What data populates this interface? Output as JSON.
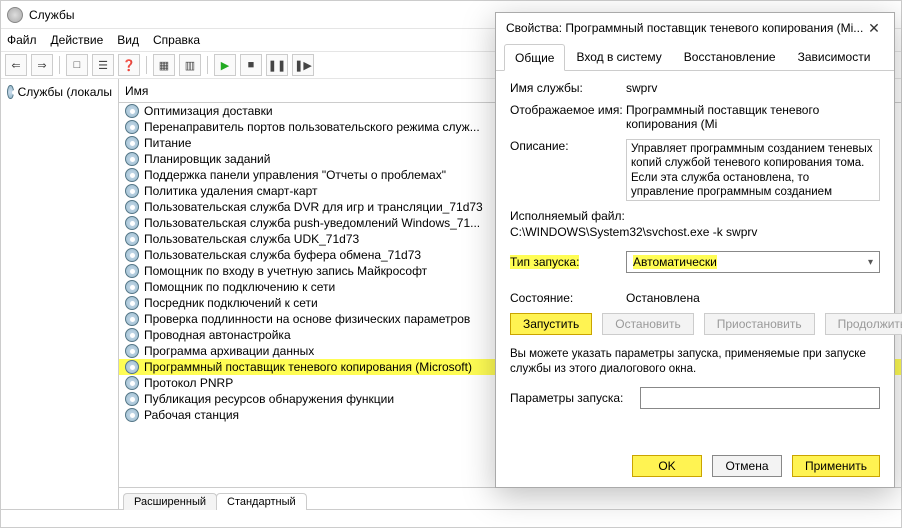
{
  "window": {
    "title": "Службы",
    "menu": {
      "file": "Файл",
      "action": "Действие",
      "view": "Вид",
      "help": "Справка"
    },
    "toolbar_icons": [
      "⇐",
      "⇒",
      "□",
      "☰",
      "❓",
      "▦",
      "▥",
      "▶",
      "■",
      "❚❚",
      "❚▶"
    ]
  },
  "left_tree": {
    "root": "Службы (локалы"
  },
  "list": {
    "header": "Имя",
    "items": [
      "Оптимизация доставки",
      "Перенаправитель портов пользовательского режима служ...",
      "Питание",
      "Планировщик заданий",
      "Поддержка панели управления \"Отчеты о проблемах\"",
      "Политика удаления смарт-карт",
      "Пользовательская служба DVR для игр и трансляции_71d73",
      "Пользовательская служба push-уведомлений Windows_71...",
      "Пользовательская служба UDK_71d73",
      "Пользовательская служба буфера обмена_71d73",
      "Помощник по входу в учетную запись Майкрософт",
      "Помощник по подключению к сети",
      "Посредник подключений к сети",
      "Проверка подлинности на основе физических параметров",
      "Проводная автонастройка",
      "Программа архивации данных",
      "Программный поставщик теневого копирования (Microsoft)",
      "Протокол PNRP",
      "Публикация ресурсов обнаружения функции",
      "Рабочая станция"
    ],
    "selected_index": 16,
    "bottom_tabs": {
      "extended": "Расширенный",
      "standard": "Стандартный"
    }
  },
  "dialog": {
    "title": "Свойства: Программный поставщик теневого копирования (Mi...",
    "tabs": {
      "general": "Общие",
      "logon": "Вход в систему",
      "recovery": "Восстановление",
      "deps": "Зависимости"
    },
    "label_service_name": "Имя службы:",
    "service_name": "swprv",
    "label_display_name": "Отображаемое имя:",
    "display_name": "Программный поставщик теневого копирования (Mi",
    "label_description": "Описание:",
    "description": "Управляет программным созданием теневых копий службой теневого копирования тома. Если эта служба остановлена, то управление программным созданием теневых копий",
    "label_exe": "Исполняемый файл:",
    "exe_path": "C:\\WINDOWS\\System32\\svchost.exe -k swprv",
    "label_startup": "Тип запуска:",
    "startup_value": "Автоматически",
    "label_state": "Состояние:",
    "state_value": "Остановлена",
    "btn_start": "Запустить",
    "btn_stop": "Остановить",
    "btn_pause": "Приостановить",
    "btn_resume": "Продолжить",
    "note": "Вы можете указать параметры запуска, применяемые при запуске службы из этого диалогового окна.",
    "label_params": "Параметры запуска:",
    "btn_ok": "OK",
    "btn_cancel": "Отмена",
    "btn_apply": "Применить"
  }
}
